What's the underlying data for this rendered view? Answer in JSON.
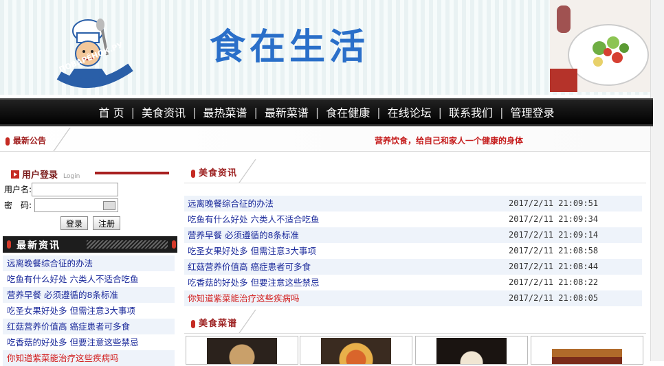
{
  "banner": {
    "title": "食在生活",
    "logo_text": "ПОВАРЁНОК.РУ"
  },
  "nav": {
    "items": [
      "首 页",
      "美食资讯",
      "最热菜谱",
      "最新菜谱",
      "食在健康",
      "在线论坛",
      "联系我们",
      "管理登录"
    ]
  },
  "notice": {
    "label": "最新公告",
    "text": "营养饮食，给自己和家人一个健康的身体"
  },
  "login": {
    "title": "用户登录",
    "title_en": "Login",
    "username_label": "用户名:",
    "password_label": "密　码:",
    "login_button": "登录",
    "register_button": "注册"
  },
  "latest_news": {
    "title": "最新资讯",
    "items": [
      "远离晚餐综合征的办法",
      "吃鱼有什么好处 六类人不适合吃鱼",
      "营养早餐 必须遵循的8条标准",
      "吃圣女果好处多 但需注意3大事项",
      "红菇营养价值高 癌症患者可多食",
      "吃香菇的好处多 但要注意这些禁忌",
      "你知道紫菜能治疗这些疾病吗"
    ]
  },
  "food_news": {
    "title": "美食资讯",
    "rows": [
      {
        "title": "远离晚餐综合征的办法",
        "date": "2017/2/11 21:09:51"
      },
      {
        "title": "吃鱼有什么好处 六类人不适合吃鱼",
        "date": "2017/2/11 21:09:34"
      },
      {
        "title": "营养早餐 必须遵循的8条标准",
        "date": "2017/2/11 21:09:14"
      },
      {
        "title": "吃圣女果好处多 但需注意3大事项",
        "date": "2017/2/11 21:08:58"
      },
      {
        "title": "红菇营养价值高 癌症患者可多食",
        "date": "2017/2/11 21:08:44"
      },
      {
        "title": "吃香菇的好处多 但要注意这些禁忌",
        "date": "2017/2/11 21:08:22"
      },
      {
        "title": "你知道紫菜能治疗这些疾病吗",
        "date": "2017/2/11 21:08:05"
      }
    ]
  },
  "recipes": {
    "title": "美食菜谱"
  },
  "colors": {
    "accent_red": "#c52a22",
    "link_blue": "#1b2a9b",
    "title_blue": "#2a6fc9"
  }
}
